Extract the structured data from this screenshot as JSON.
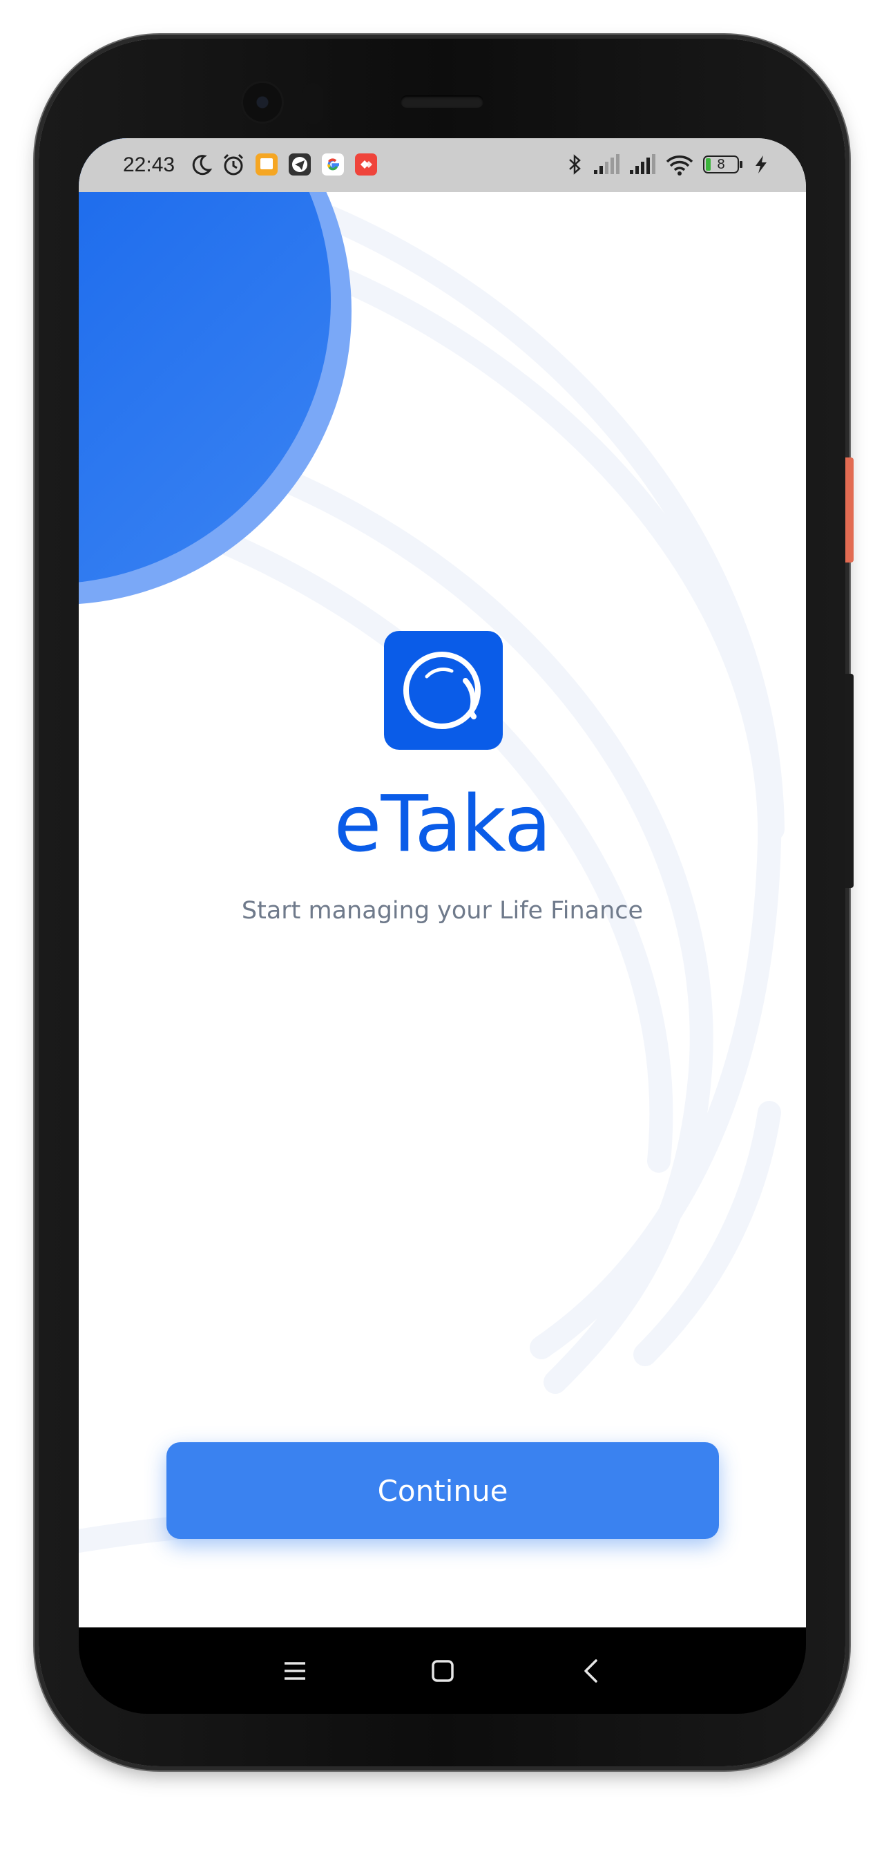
{
  "status_bar": {
    "time": "22:43",
    "battery_level": "8",
    "notification_icons": [
      "moon-icon",
      "alarm-icon",
      "notes-app-icon",
      "telegram-icon",
      "google-icon",
      "anydesk-icon"
    ],
    "system_icons": [
      "bluetooth-icon",
      "signal-1-icon",
      "signal-2-icon",
      "wifi-icon",
      "battery-icon",
      "charging-icon"
    ]
  },
  "app": {
    "name": "eTaka",
    "tagline": "Start managing your Life Finance",
    "continue_label": "Continue"
  },
  "colors": {
    "brand_blue": "#0a5ce8",
    "button_blue": "#3a82f0",
    "tagline_gray": "#6f7a8b",
    "status_bar_bg": "#cdcdcd"
  },
  "navigation_bar": {
    "buttons": [
      "menu-icon",
      "home-icon",
      "back-icon"
    ]
  }
}
